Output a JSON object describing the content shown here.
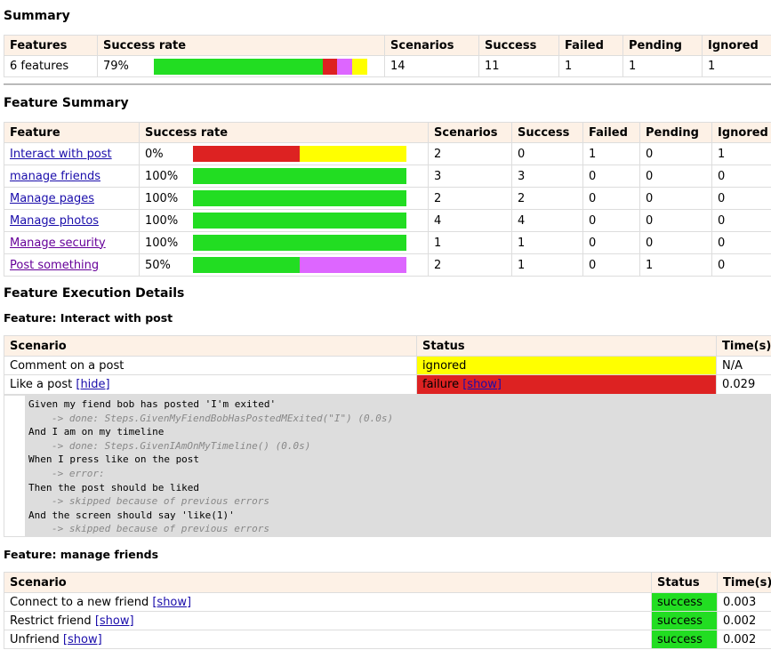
{
  "summary": {
    "title": "Summary",
    "headers": [
      "Features",
      "Success rate",
      "Scenarios",
      "Success",
      "Failed",
      "Pending",
      "Ignored"
    ],
    "features": "6 features",
    "rate": "79%",
    "bar": {
      "success": 0.79,
      "failed": 0.07,
      "pending": 0.07,
      "ignored": 0.07
    },
    "scenarios": "14",
    "success": "11",
    "failed": "1",
    "pending": "1",
    "ignored": "1"
  },
  "feature_summary": {
    "title": "Feature Summary",
    "headers": [
      "Feature",
      "Success rate",
      "Scenarios",
      "Success",
      "Failed",
      "Pending",
      "Ignored"
    ],
    "rows": [
      {
        "name": "Interact with post",
        "rate": "0%",
        "bar": {
          "success": 0,
          "failed": 0.5,
          "pending": 0,
          "ignored": 0.5
        },
        "scenarios": "2",
        "success": "0",
        "failed": "1",
        "pending": "0",
        "ignored": "1"
      },
      {
        "name": "manage friends",
        "rate": "100%",
        "bar": {
          "success": 1,
          "failed": 0,
          "pending": 0,
          "ignored": 0
        },
        "scenarios": "3",
        "success": "3",
        "failed": "0",
        "pending": "0",
        "ignored": "0"
      },
      {
        "name": "Manage pages",
        "rate": "100%",
        "bar": {
          "success": 1,
          "failed": 0,
          "pending": 0,
          "ignored": 0
        },
        "scenarios": "2",
        "success": "2",
        "failed": "0",
        "pending": "0",
        "ignored": "0"
      },
      {
        "name": "Manage photos",
        "rate": "100%",
        "bar": {
          "success": 1,
          "failed": 0,
          "pending": 0,
          "ignored": 0
        },
        "scenarios": "4",
        "success": "4",
        "failed": "0",
        "pending": "0",
        "ignored": "0"
      },
      {
        "name": "Manage security",
        "rate": "100%",
        "bar": {
          "success": 1,
          "failed": 0,
          "pending": 0,
          "ignored": 0
        },
        "scenarios": "1",
        "success": "1",
        "failed": "0",
        "pending": "0",
        "ignored": "0"
      },
      {
        "name": "Post something",
        "rate": "50%",
        "bar": {
          "success": 0.5,
          "failed": 0,
          "pending": 0.5,
          "ignored": 0
        },
        "scenarios": "2",
        "success": "1",
        "failed": "0",
        "pending": "1",
        "ignored": "0"
      }
    ]
  },
  "details": {
    "title": "Feature Execution Details",
    "scenario_header": "Scenario",
    "status_header": "Status",
    "time_header": "Time(s)",
    "f1": {
      "title": "Feature: Interact with post",
      "rows": [
        {
          "name": "Comment on a post",
          "link": "",
          "status": "ignored",
          "status_link": "",
          "time": "N/A"
        },
        {
          "name": "Like a post",
          "link": "[hide]",
          "status": "failure",
          "status_link": "[show]",
          "time": "0.029"
        }
      ],
      "log": [
        {
          "type": "step",
          "text": "Given my fiend bob has posted 'I'm exited'"
        },
        {
          "type": "sub",
          "text": "-> done: Steps.GivenMyFiendBobHasPostedMExited(\"I\") (0.0s)"
        },
        {
          "type": "step",
          "text": "And I am on my timeline"
        },
        {
          "type": "sub",
          "text": "-> done: Steps.GivenIAmOnMyTimeline() (0.0s)"
        },
        {
          "type": "step",
          "text": "When I press like on the post"
        },
        {
          "type": "sub",
          "text": "-> error:"
        },
        {
          "type": "step",
          "text": "Then the post should be liked"
        },
        {
          "type": "sub",
          "text": "-> skipped because of previous errors"
        },
        {
          "type": "step",
          "text": "And the screen should say 'like(1)'"
        },
        {
          "type": "sub",
          "text": "-> skipped because of previous errors"
        }
      ]
    },
    "f2": {
      "title": "Feature: manage friends",
      "rows": [
        {
          "name": "Connect to a new friend",
          "link": "[show]",
          "status": "success",
          "time": "0.003"
        },
        {
          "name": "Restrict friend",
          "link": "[show]",
          "status": "success",
          "time": "0.002"
        },
        {
          "name": "Unfriend",
          "link": "[show]",
          "status": "success",
          "time": "0.002"
        }
      ]
    }
  },
  "colors": {
    "success": "#22dd22",
    "failed": "#dd2222",
    "pending": "#dd66ff",
    "ignored": "#ffff00",
    "header_bg": "#fdf1e6"
  }
}
